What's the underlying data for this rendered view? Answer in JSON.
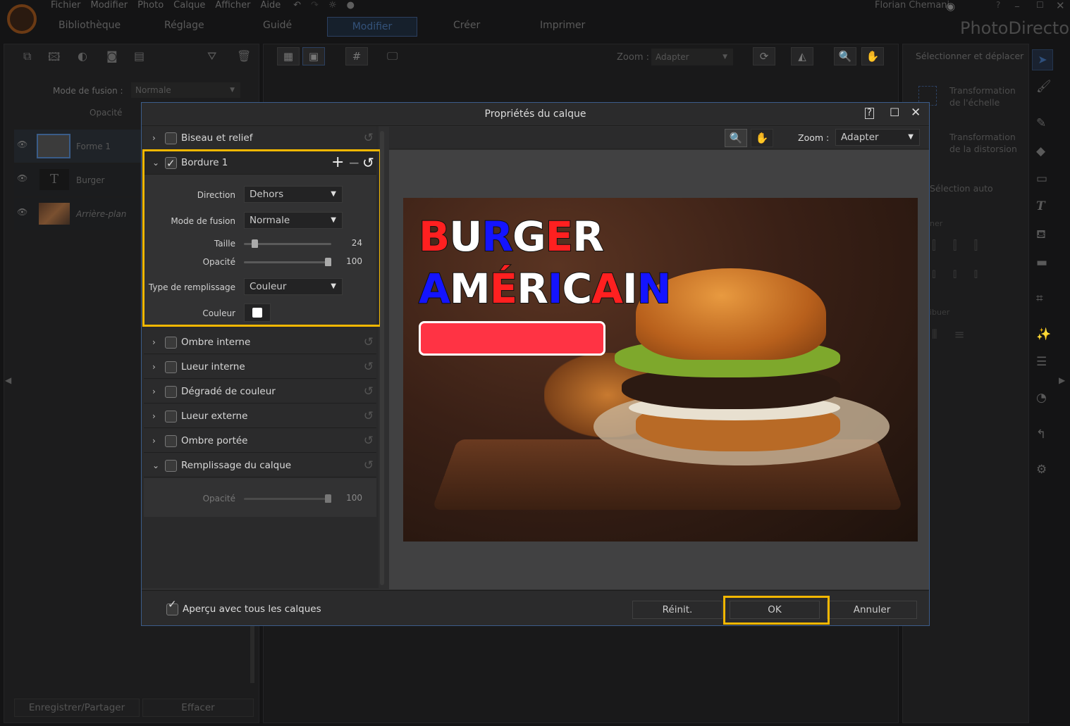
{
  "app": {
    "name": "PhotoDirector",
    "user": "Florian Chemani"
  },
  "menu": [
    "Fichier",
    "Modifier",
    "Photo",
    "Calque",
    "Afficher",
    "Aide"
  ],
  "nav_tabs": [
    {
      "label": "Bibliothèque"
    },
    {
      "label": "Réglage"
    },
    {
      "label": "Guidé"
    },
    {
      "label": "Modifier",
      "active": true
    },
    {
      "label": "Créer"
    },
    {
      "label": "Imprimer"
    }
  ],
  "left_panel": {
    "blend_label": "Mode de fusion :",
    "blend_value": "Normale",
    "opacity_label": "Opacité",
    "layers": [
      {
        "name": "Forme 1",
        "selected": true
      },
      {
        "name": "Burger"
      },
      {
        "name": "Arrière-plan"
      }
    ],
    "save_share": "Enregistrer/Partager",
    "erase": "Effacer"
  },
  "center_toolbar": {
    "zoom_label": "Zoom :",
    "zoom_value": "Adapter"
  },
  "right_panel": {
    "select_move": "Sélectionner et déplacer",
    "scale_transform": [
      "Transformation",
      "de l'échelle"
    ],
    "distort_transform": [
      "Transformation",
      "de la distorsion"
    ],
    "auto_select": "Sélection auto",
    "align_partial": "ner",
    "distribute_partial": "ibuer"
  },
  "dialog": {
    "title": "Propriétés du calque",
    "zoom_label": "Zoom :",
    "zoom_value": "Adapter",
    "effects": [
      {
        "label": "Biseau et relief",
        "checked": false,
        "expanded": false
      },
      {
        "label": "Bordure 1",
        "checked": true,
        "expanded": true
      },
      {
        "label": "Ombre interne",
        "checked": false
      },
      {
        "label": "Lueur interne",
        "checked": false
      },
      {
        "label": "Dégradé de couleur",
        "checked": false
      },
      {
        "label": "Lueur externe",
        "checked": false
      },
      {
        "label": "Ombre portée",
        "checked": false
      },
      {
        "label": "Remplissage du calque",
        "checked": false,
        "expanded": true
      }
    ],
    "border": {
      "direction_label": "Direction",
      "direction": "Dehors",
      "blend_label": "Mode de fusion",
      "blend": "Normale",
      "size_label": "Taille",
      "size": 24,
      "size_max": 250,
      "opacity_label": "Opacité",
      "opacity": 100,
      "fill_type_label": "Type de remplissage",
      "fill_type": "Couleur",
      "color_label": "Couleur",
      "color": "#ffffff"
    },
    "fill": {
      "opacity_label": "Opacité",
      "opacity": 100
    },
    "preview_all": "Aperçu avec tous les calques",
    "preview_all_checked": true,
    "reset": "Réinit.",
    "ok": "OK",
    "cancel": "Annuler",
    "highlight_color": "#f3b700"
  },
  "preview": {
    "line1": [
      "B",
      "U",
      "R",
      "G",
      "E",
      "R"
    ],
    "line1_colors": [
      "#ff2020",
      "#ffffff",
      "#1414ff",
      "#ffffff",
      "#ff2020",
      "#ffffff"
    ],
    "line2": [
      "A",
      "M",
      "É",
      "R",
      "I",
      "C",
      "A",
      "I",
      "N"
    ],
    "line2_colors": [
      "#1414ff",
      "#ffffff",
      "#ff2020",
      "#ffffff",
      "#1414ff",
      "#ffffff",
      "#ff2020",
      "#ffffff",
      "#1414ff"
    ],
    "shape_color": "#ff3344"
  }
}
